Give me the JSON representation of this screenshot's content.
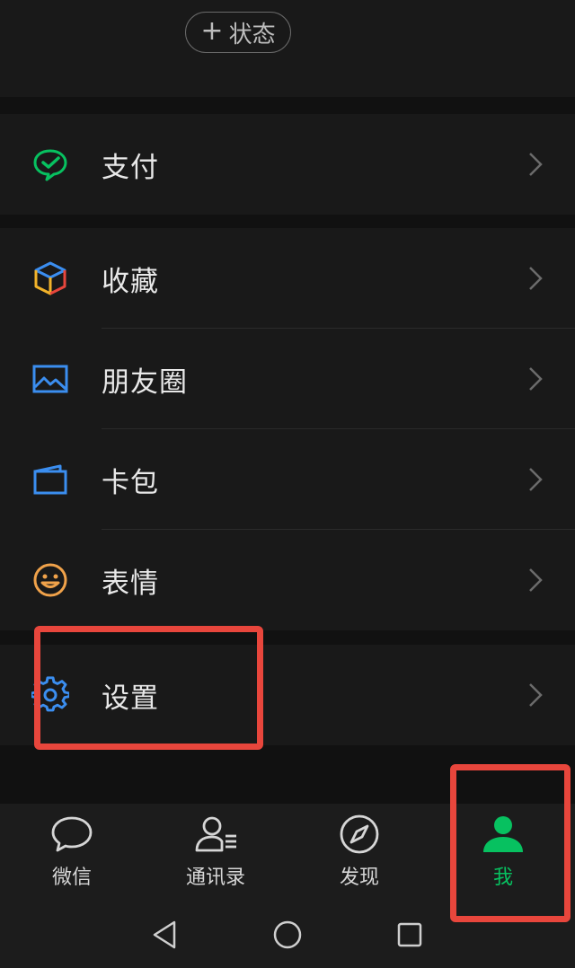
{
  "status_button": {
    "label": "状态",
    "icon": "plus-icon"
  },
  "sections": {
    "pay": {
      "label": "支付",
      "icon": "pay-icon",
      "color": "#07c160"
    },
    "favorites": {
      "label": "收藏",
      "icon": "cube-icon"
    },
    "moments": {
      "label": "朋友圈",
      "icon": "photo-icon",
      "color": "#3b8ef0"
    },
    "cards": {
      "label": "卡包",
      "icon": "wallet-icon",
      "color": "#3b8ef0"
    },
    "stickers": {
      "label": "表情",
      "icon": "smiley-icon",
      "color": "#f0a24a"
    },
    "settings": {
      "label": "设置",
      "icon": "gear-icon",
      "color": "#3b8ef0"
    }
  },
  "tabbar": {
    "tabs": [
      {
        "label": "微信",
        "icon": "chat-bubble-icon"
      },
      {
        "label": "通讯录",
        "icon": "contacts-icon"
      },
      {
        "label": "发现",
        "icon": "compass-icon"
      },
      {
        "label": "我",
        "icon": "person-icon",
        "active": true
      }
    ],
    "active_color": "#07c160"
  },
  "highlight_color": "#e8463c"
}
